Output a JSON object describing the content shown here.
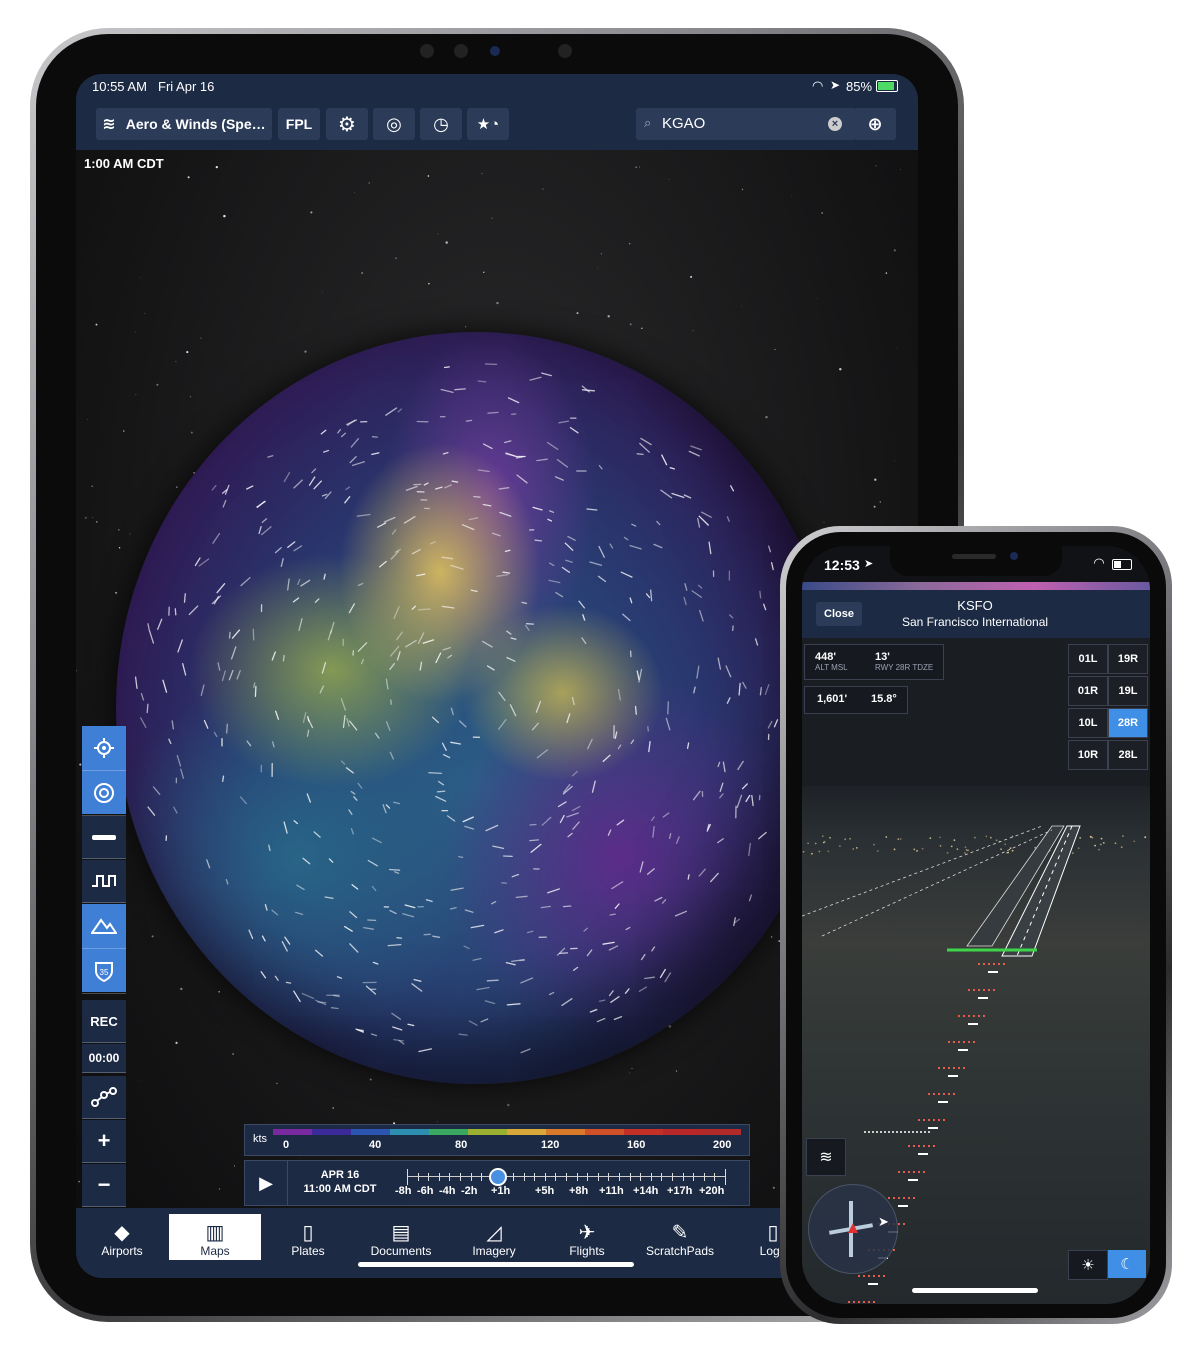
{
  "ipad": {
    "status": {
      "time": "10:55 AM",
      "date": "Fri Apr 16",
      "battery": "85%"
    },
    "toolbar": {
      "layer_button": "Aero & Winds (Spe…",
      "fpl_button": "FPL",
      "search_value": "KGAO"
    },
    "map_time": "1:00 AM CDT",
    "sidebar": {
      "rec_label": "REC",
      "rec_timer": "00:00"
    },
    "legend": {
      "unit": "kts",
      "ticks": [
        "0",
        "40",
        "80",
        "120",
        "160",
        "200"
      ],
      "colors": [
        "#7a2aa0",
        "#3b2a9a",
        "#2b55b0",
        "#2d8fb0",
        "#3aa860",
        "#9ab030",
        "#d8a83a",
        "#d87a2a",
        "#d0502a",
        "#c23028",
        "#b82828",
        "#b02a2a"
      ]
    },
    "timeline": {
      "date": "APR 16",
      "time": "11:00 AM CDT",
      "ticks": [
        "-8h",
        "-6h",
        "-4h",
        "-2h",
        "+1h",
        "+5h",
        "+8h",
        "+11h",
        "+14h",
        "+17h",
        "+20h"
      ]
    },
    "tabs": [
      {
        "label": "Airports",
        "icon": "airports-icon"
      },
      {
        "label": "Maps",
        "icon": "maps-icon"
      },
      {
        "label": "Plates",
        "icon": "plates-icon"
      },
      {
        "label": "Documents",
        "icon": "documents-icon"
      },
      {
        "label": "Imagery",
        "icon": "imagery-icon"
      },
      {
        "label": "Flights",
        "icon": "flights-icon"
      },
      {
        "label": "ScratchPads",
        "icon": "scratchpads-icon"
      },
      {
        "label": "Logb",
        "icon": "logbook-icon"
      }
    ],
    "selected_tab": "Maps"
  },
  "iphone": {
    "status": {
      "time": "12:53"
    },
    "header": {
      "close": "Close",
      "airport_code": "KSFO",
      "airport_name": "San Francisco International"
    },
    "info": {
      "alt_value": "448'",
      "alt_label": "ALT MSL",
      "tdze_value": "13'",
      "tdze_label": "RWY 28R TDZE",
      "dist_value": "1,601'",
      "angle_value": "15.8°"
    },
    "runways": [
      [
        "01L",
        "19R"
      ],
      [
        "01R",
        "19L"
      ],
      [
        "10L",
        "28R"
      ],
      [
        "10R",
        "28L"
      ]
    ],
    "selected_runway": "28R"
  }
}
